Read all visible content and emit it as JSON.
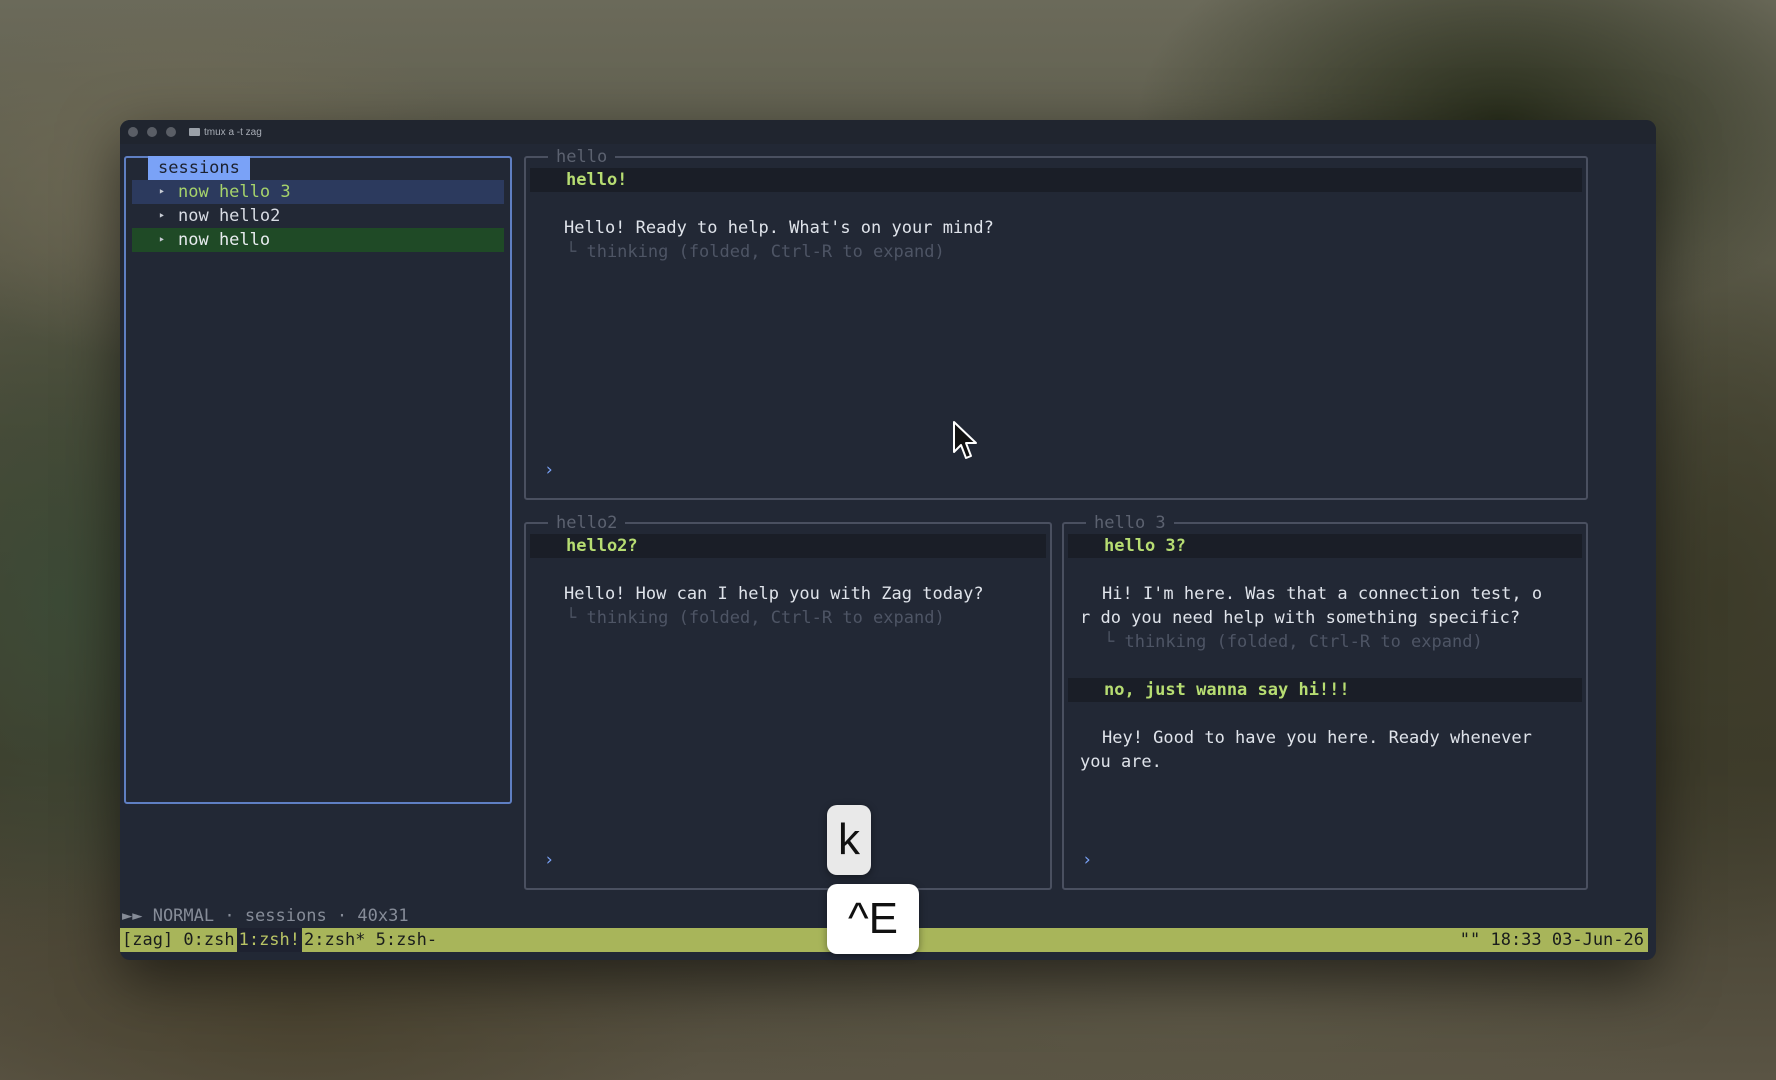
{
  "window": {
    "title": "tmux a -t zag"
  },
  "sidebar": {
    "tab_label": "sessions",
    "items": [
      {
        "bullet": "‣",
        "label": "now hello 3"
      },
      {
        "bullet": "‣",
        "label": "now hello2"
      },
      {
        "bullet": "‣",
        "label": "now hello"
      }
    ]
  },
  "panes": {
    "hello": {
      "title": "hello",
      "user_message": "hello!",
      "reply": "Hello! Ready to help. What's on your mind?",
      "thinking": "└ thinking (folded, Ctrl-R to expand)",
      "prompt": "›"
    },
    "hello2": {
      "title": "hello2",
      "user_message": "hello2?",
      "reply": "Hello! How can I help you with Zag today?",
      "thinking": "└ thinking (folded, Ctrl-R to expand)",
      "prompt": "›"
    },
    "hello3": {
      "title": "hello 3",
      "user_message": "hello 3?",
      "reply_line1": "Hi! I'm here. Was that a connection test, o",
      "reply_line2": "r do you need help with something specific?",
      "thinking": "└ thinking (folded, Ctrl-R to expand)",
      "user_message2": "no, just wanna say hi!!!",
      "reply2_line1": "Hey! Good to have you here. Ready whenever",
      "reply2_line2": "you are.",
      "prompt": "›"
    }
  },
  "status": {
    "text": "►► NORMAL · sessions · 40x31"
  },
  "tmux": {
    "session": "[zag] 0:zsh ",
    "current_window": "1:zsh!",
    "others": " 2:zsh* 5:zsh-",
    "right": "\"\" 18:33 03-Jun-26"
  },
  "keys": {
    "k": "k",
    "ctrl_e": "^E"
  },
  "colors": {
    "accent_blue": "#7aa2f7",
    "user_text": "#b7dd72",
    "tmux_bar": "#a8b55a"
  }
}
